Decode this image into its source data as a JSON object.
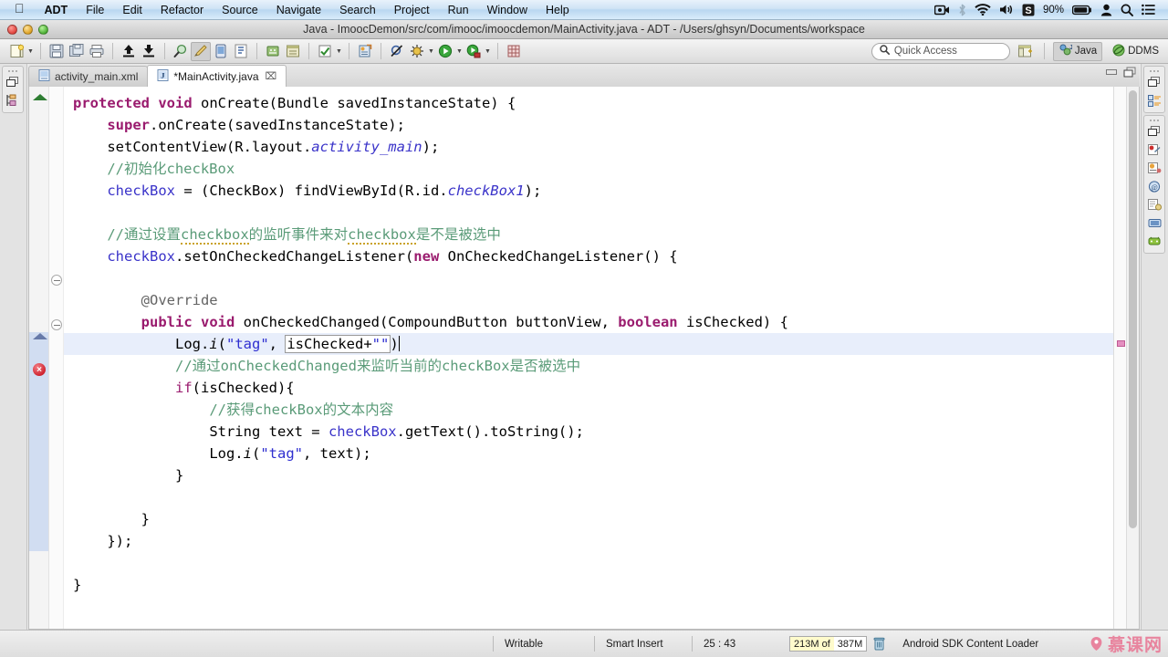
{
  "mac_menu": {
    "apple_icon": "apple-logo-icon",
    "items": [
      "ADT",
      "File",
      "Edit",
      "Refactor",
      "Source",
      "Navigate",
      "Search",
      "Project",
      "Run",
      "Window",
      "Help"
    ],
    "status_icons": [
      "screen-recorder-icon",
      "bluetooth-icon",
      "wifi-icon",
      "volume-icon",
      "snagit-icon"
    ],
    "battery_percent": "90%",
    "battery_icon": "battery-icon",
    "user_icon": "user-account-icon",
    "spotlight_icon": "search-icon",
    "notification_icon": "notification-center-icon"
  },
  "window": {
    "title": "Java - ImoocDemon/src/com/imooc/imoocdemon/MainActivity.java - ADT - /Users/ghsyn/Documents/workspace",
    "close_label": "close-window",
    "minimize_label": "minimize-window",
    "zoom_label": "zoom-window"
  },
  "toolbar": {
    "buttons": [
      {
        "name": "new-wizard-button",
        "icon": "new-file-icon",
        "dropdown": true
      },
      {
        "name": "save-button",
        "icon": "save-icon",
        "dropdown": false
      },
      {
        "name": "save-all-button",
        "icon": "save-all-icon",
        "dropdown": false
      },
      {
        "name": "print-button",
        "icon": "print-icon",
        "dropdown": false
      },
      {
        "name": "export-button",
        "icon": "export-up-icon",
        "dropdown": false
      },
      {
        "name": "import-button",
        "icon": "import-down-icon",
        "dropdown": false
      },
      {
        "name": "debug-tools-button",
        "icon": "magnifier-icon",
        "dropdown": false
      },
      {
        "name": "android-sdk-manager-button",
        "icon": "android-sdk-manager-icon",
        "dropdown": false
      },
      {
        "name": "avd-manager-button",
        "icon": "avd-manager-icon",
        "dropdown": false
      },
      {
        "name": "lint-warnings-button",
        "icon": "lint-icon",
        "dropdown": false
      },
      {
        "name": "new-android-project-button",
        "icon": "android-project-icon",
        "dropdown": false
      },
      {
        "name": "open-perspective-button",
        "icon": "perspective-icon",
        "dropdown": false
      },
      {
        "name": "check-button",
        "icon": "checkmark-icon",
        "dropdown": true
      },
      {
        "name": "new-java-class-button",
        "icon": "java-class-icon",
        "dropdown": false
      },
      {
        "name": "skip-breakpoints-button",
        "icon": "skip-breakpoints-icon",
        "dropdown": false
      },
      {
        "name": "debug-button",
        "icon": "debug-bug-icon",
        "dropdown": true
      },
      {
        "name": "run-button",
        "icon": "run-play-icon",
        "dropdown": true
      },
      {
        "name": "external-tools-button",
        "icon": "external-tools-icon",
        "dropdown": true
      },
      {
        "name": "new-window-button",
        "icon": "grid-icon",
        "dropdown": false
      }
    ],
    "quick_access_placeholder": "Quick Access",
    "quick_access_value": "",
    "quick_access_icon": "search-icon",
    "open-perspective": {
      "name": "open-perspective-button",
      "icon": "open-perspective-icon"
    },
    "perspectives": [
      {
        "label": "Java",
        "icon": "java-perspective-icon",
        "selected": true
      },
      {
        "label": "DDMS",
        "icon": "ddms-perspective-icon",
        "selected": false
      }
    ]
  },
  "left_minimized_views": [
    {
      "name": "restore-package-explorer",
      "icon": "restore-icon"
    },
    {
      "name": "package-explorer-view",
      "icon": "package-explorer-icon"
    }
  ],
  "right_minimized_views": [
    {
      "name": "restore-outline",
      "icon": "restore-icon"
    },
    {
      "name": "outline-view",
      "icon": "outline-icon"
    },
    {
      "name": "restore-views",
      "icon": "restore-icon"
    },
    {
      "name": "problems-view",
      "icon": "problems-icon"
    },
    {
      "name": "javadoc-view",
      "icon": "javadoc-icon"
    },
    {
      "name": "declaration-view",
      "icon": "declaration-icon"
    },
    {
      "name": "console-view",
      "icon": "console-icon"
    },
    {
      "name": "logcat-view",
      "icon": "logcat-icon"
    }
  ],
  "editor": {
    "tabs": [
      {
        "label": "activity_main.xml",
        "icon": "xml-file-icon",
        "active": false,
        "closable": false
      },
      {
        "label": "*MainActivity.java",
        "icon": "java-file-icon",
        "active": true,
        "closable": true,
        "close_glyph": "⌧"
      }
    ],
    "minimize_label": "minimize-editor",
    "maximize_label": "maximize-editor",
    "gutter_markers": {
      "error_glyph": "×",
      "error_tooltip": "error-marker",
      "fold_collapse_glyph": "−"
    }
  },
  "code": {
    "lines": [
      "    protected void onCreate(Bundle savedInstanceState) {",
      "        super.onCreate(savedInstanceState);",
      "        setContentView(R.layout.activity_main);",
      "        //初始化checkBox",
      "        checkBox = (CheckBox) findViewById(R.id.checkBox1);",
      "",
      "        //通过设置checkbox的监听事件来对checkbox是不是被选中",
      "        checkBox.setOnCheckedChangeListener(new OnCheckedChangeListener() {",
      "",
      "            @Override",
      "            public void onCheckedChanged(CompoundButton buttonView, boolean isChecked) {",
      "                Log.i(\"tag\", isChecked+\"\")",
      "                //通过onCheckedChanged来监听当前的checkBox是否被选中",
      "                if(isChecked){",
      "                    //获得checkBox的文本内容",
      "                    String text = checkBox.getText().toString();",
      "                    Log.i(\"tag\", text);",
      "                }",
      "",
      "            }",
      "        });",
      "",
      "    }"
    ]
  },
  "status": {
    "writable": "Writable",
    "insert_mode": "Smart Insert",
    "cursor_position": "25 : 43",
    "memory_used": "213M of",
    "memory_total": "387M",
    "gc_icon": "trash-gc-icon",
    "job": "Android SDK Content Loader",
    "watermark": "慕课网"
  }
}
